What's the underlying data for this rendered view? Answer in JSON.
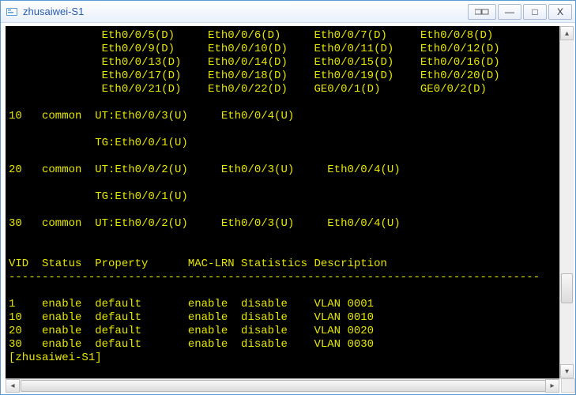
{
  "window": {
    "title": "zhusaiwei-S1"
  },
  "terminal": {
    "lines": [
      "              Eth0/0/5(D)     Eth0/0/6(D)     Eth0/0/7(D)     Eth0/0/8(D)",
      "              Eth0/0/9(D)     Eth0/0/10(D)    Eth0/0/11(D)    Eth0/0/12(D)",
      "              Eth0/0/13(D)    Eth0/0/14(D)    Eth0/0/15(D)    Eth0/0/16(D)",
      "              Eth0/0/17(D)    Eth0/0/18(D)    Eth0/0/19(D)    Eth0/0/20(D)",
      "              Eth0/0/21(D)    Eth0/0/22(D)    GE0/0/1(D)      GE0/0/2(D)",
      "",
      "10   common  UT:Eth0/0/3(U)     Eth0/0/4(U)",
      "",
      "             TG:Eth0/0/1(U)",
      "",
      "20   common  UT:Eth0/0/2(U)     Eth0/0/3(U)     Eth0/0/4(U)",
      "",
      "             TG:Eth0/0/1(U)",
      "",
      "30   common  UT:Eth0/0/2(U)     Eth0/0/3(U)     Eth0/0/4(U)",
      "",
      "",
      "VID  Status  Property      MAC-LRN Statistics Description",
      "--------------------------------------------------------------------------------",
      "",
      "1    enable  default       enable  disable    VLAN 0001",
      "10   enable  default       enable  disable    VLAN 0010",
      "20   enable  default       enable  disable    VLAN 0020",
      "30   enable  default       enable  disable    VLAN 0030",
      "[zhusaiwei-S1]"
    ]
  },
  "buttons": {
    "tab_switch": " ",
    "minimize": "—",
    "maximize": "□",
    "close": "X"
  },
  "vlan_config": [
    {
      "vid": "10",
      "type": "common",
      "ut_ports": [
        "Eth0/0/3(U)",
        "Eth0/0/4(U)"
      ],
      "tg_ports": [
        "Eth0/0/1(U)"
      ]
    },
    {
      "vid": "20",
      "type": "common",
      "ut_ports": [
        "Eth0/0/2(U)",
        "Eth0/0/3(U)",
        "Eth0/0/4(U)"
      ],
      "tg_ports": [
        "Eth0/0/1(U)"
      ]
    },
    {
      "vid": "30",
      "type": "common",
      "ut_ports": [
        "Eth0/0/2(U)",
        "Eth0/0/3(U)",
        "Eth0/0/4(U)"
      ],
      "tg_ports": []
    }
  ],
  "vlan_status_table": {
    "headers": [
      "VID",
      "Status",
      "Property",
      "MAC-LRN",
      "Statistics",
      "Description"
    ],
    "rows": [
      {
        "VID": "1",
        "Status": "enable",
        "Property": "default",
        "MAC-LRN": "enable",
        "Statistics": "disable",
        "Description": "VLAN 0001"
      },
      {
        "VID": "10",
        "Status": "enable",
        "Property": "default",
        "MAC-LRN": "enable",
        "Statistics": "disable",
        "Description": "VLAN 0010"
      },
      {
        "VID": "20",
        "Status": "enable",
        "Property": "default",
        "MAC-LRN": "enable",
        "Statistics": "disable",
        "Description": "VLAN 0020"
      },
      {
        "VID": "30",
        "Status": "enable",
        "Property": "default",
        "MAC-LRN": "enable",
        "Statistics": "disable",
        "Description": "VLAN 0030"
      }
    ]
  },
  "prompt": "[zhusaiwei-S1]"
}
